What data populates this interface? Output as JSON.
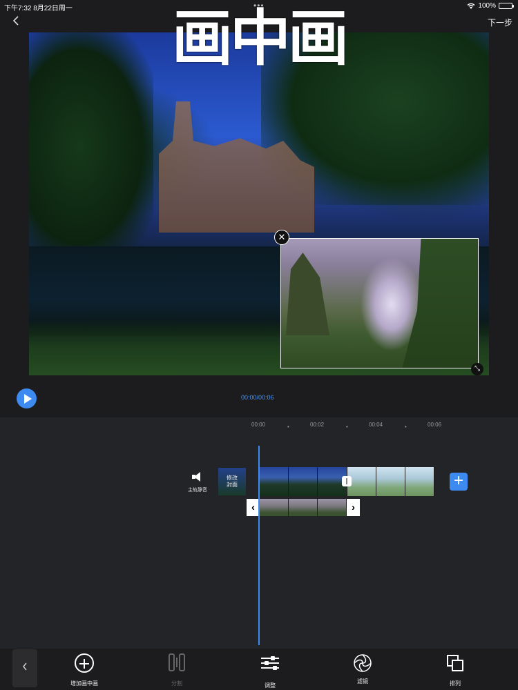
{
  "status_bar": {
    "time_date": "下午7:32   8月22日周一",
    "dots": "•••",
    "battery": "100%"
  },
  "header": {
    "back_icon": "chevron-left-icon",
    "title_overlay": "画中画",
    "next_label": "下一步"
  },
  "preview": {
    "pip_close_icon": "close-icon",
    "pip_resize_icon": "resize-icon"
  },
  "player": {
    "play_icon": "play-icon",
    "time_readout": "00:00/00:06"
  },
  "timeline": {
    "ticks": [
      "00:00",
      "00:02",
      "00:04",
      "00:06"
    ],
    "mute_label": "主轨静音",
    "cover_label": "修改\n封面",
    "accent": "#3d8bf0"
  },
  "toolbar": {
    "collapse_icon": "chevron-left-icon",
    "items": [
      {
        "label": "增加画中画",
        "icon": "plus-circle-icon",
        "enabled": true
      },
      {
        "label": "分割",
        "icon": "split-icon",
        "enabled": false
      },
      {
        "label": "调整",
        "icon": "sliders-icon",
        "enabled": true
      },
      {
        "label": "滤镜",
        "icon": "filter-icon",
        "enabled": true
      },
      {
        "label": "排列",
        "icon": "arrange-icon",
        "enabled": true
      }
    ]
  }
}
